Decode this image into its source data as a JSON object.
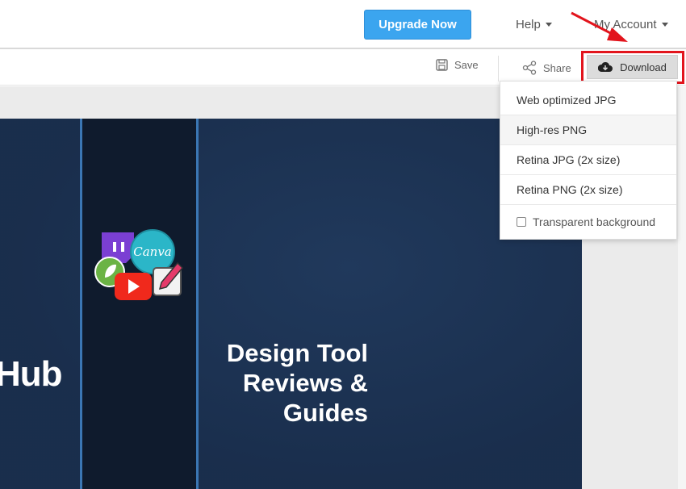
{
  "topbar": {
    "upgrade_label": "Upgrade Now",
    "help_label": "Help",
    "account_label": "My Account"
  },
  "toolbar": {
    "save_label": "Save",
    "share_label": "Share",
    "download_label": "Download"
  },
  "download_menu": {
    "items": [
      {
        "label": "Web optimized JPG"
      },
      {
        "label": "High-res PNG"
      },
      {
        "label": "Retina JPG (2x size)"
      },
      {
        "label": "Retina PNG (2x size)"
      }
    ],
    "checkbox_label": "Transparent background",
    "checkbox_checked": false
  },
  "canvas": {
    "left_text": "Hub",
    "headline_line1": "Design Tool",
    "headline_line2": "Reviews &",
    "headline_line3": "Guides",
    "canva_logo_text": "Canva"
  },
  "colors": {
    "accent": "#3ba5ef",
    "canvas_bg": "#1c3252",
    "highlight": "#e2141c"
  }
}
